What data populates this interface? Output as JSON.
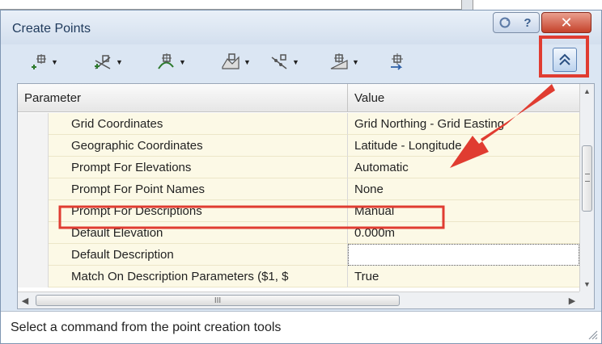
{
  "window": {
    "title": "Create Points",
    "help_label": "?",
    "close_label": "✕",
    "options_icon": "circle-arrow-icon"
  },
  "toolbar": {
    "tools": [
      {
        "name": "point-tool-miscellaneous",
        "icon": "point-plus-icon"
      },
      {
        "name": "point-tool-intersection",
        "icon": "point-intersection-icon"
      },
      {
        "name": "point-tool-alignment",
        "icon": "point-alignment-icon"
      },
      {
        "name": "point-tool-surface",
        "icon": "point-surface-icon"
      },
      {
        "name": "point-tool-interpolate",
        "icon": "point-interpolate-icon"
      },
      {
        "name": "point-tool-slope",
        "icon": "point-slope-icon"
      },
      {
        "name": "point-tool-convert",
        "icon": "point-convert-icon"
      }
    ],
    "collapse_icon": "double-chevron-up-icon"
  },
  "grid": {
    "header": {
      "parameter": "Parameter",
      "value": "Value"
    },
    "rows": [
      {
        "parameter": "Grid Coordinates",
        "value": "Grid Northing - Grid Easting"
      },
      {
        "parameter": "Geographic Coordinates",
        "value": "Latitude - Longitude"
      },
      {
        "parameter": "Prompt For Elevations",
        "value": "Automatic"
      },
      {
        "parameter": "Prompt For Point Names",
        "value": "None"
      },
      {
        "parameter": "Prompt For Descriptions",
        "value": "Manual"
      },
      {
        "parameter": "Default Elevation",
        "value": "0.000m"
      },
      {
        "parameter": "Default Description",
        "value": ""
      },
      {
        "parameter": "Match On Description Parameters ($1, $",
        "value": "True"
      }
    ],
    "hscroll_grip": "III"
  },
  "status": {
    "text": "Select a command from the point creation tools"
  },
  "annotation": {
    "highlight_color": "#e03c31"
  }
}
